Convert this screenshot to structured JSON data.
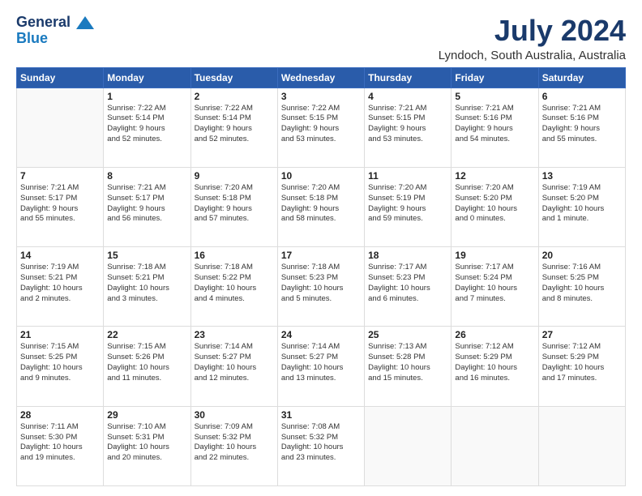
{
  "header": {
    "logo_line1": "General",
    "logo_line2": "Blue",
    "title": "July 2024",
    "subtitle": "Lyndoch, South Australia, Australia"
  },
  "weekdays": [
    "Sunday",
    "Monday",
    "Tuesday",
    "Wednesday",
    "Thursday",
    "Friday",
    "Saturday"
  ],
  "weeks": [
    [
      {
        "day": "",
        "info": ""
      },
      {
        "day": "1",
        "info": "Sunrise: 7:22 AM\nSunset: 5:14 PM\nDaylight: 9 hours\nand 52 minutes."
      },
      {
        "day": "2",
        "info": "Sunrise: 7:22 AM\nSunset: 5:14 PM\nDaylight: 9 hours\nand 52 minutes."
      },
      {
        "day": "3",
        "info": "Sunrise: 7:22 AM\nSunset: 5:15 PM\nDaylight: 9 hours\nand 53 minutes."
      },
      {
        "day": "4",
        "info": "Sunrise: 7:21 AM\nSunset: 5:15 PM\nDaylight: 9 hours\nand 53 minutes."
      },
      {
        "day": "5",
        "info": "Sunrise: 7:21 AM\nSunset: 5:16 PM\nDaylight: 9 hours\nand 54 minutes."
      },
      {
        "day": "6",
        "info": "Sunrise: 7:21 AM\nSunset: 5:16 PM\nDaylight: 9 hours\nand 55 minutes."
      }
    ],
    [
      {
        "day": "7",
        "info": "Sunrise: 7:21 AM\nSunset: 5:17 PM\nDaylight: 9 hours\nand 55 minutes."
      },
      {
        "day": "8",
        "info": "Sunrise: 7:21 AM\nSunset: 5:17 PM\nDaylight: 9 hours\nand 56 minutes."
      },
      {
        "day": "9",
        "info": "Sunrise: 7:20 AM\nSunset: 5:18 PM\nDaylight: 9 hours\nand 57 minutes."
      },
      {
        "day": "10",
        "info": "Sunrise: 7:20 AM\nSunset: 5:18 PM\nDaylight: 9 hours\nand 58 minutes."
      },
      {
        "day": "11",
        "info": "Sunrise: 7:20 AM\nSunset: 5:19 PM\nDaylight: 9 hours\nand 59 minutes."
      },
      {
        "day": "12",
        "info": "Sunrise: 7:20 AM\nSunset: 5:20 PM\nDaylight: 10 hours\nand 0 minutes."
      },
      {
        "day": "13",
        "info": "Sunrise: 7:19 AM\nSunset: 5:20 PM\nDaylight: 10 hours\nand 1 minute."
      }
    ],
    [
      {
        "day": "14",
        "info": "Sunrise: 7:19 AM\nSunset: 5:21 PM\nDaylight: 10 hours\nand 2 minutes."
      },
      {
        "day": "15",
        "info": "Sunrise: 7:18 AM\nSunset: 5:21 PM\nDaylight: 10 hours\nand 3 minutes."
      },
      {
        "day": "16",
        "info": "Sunrise: 7:18 AM\nSunset: 5:22 PM\nDaylight: 10 hours\nand 4 minutes."
      },
      {
        "day": "17",
        "info": "Sunrise: 7:18 AM\nSunset: 5:23 PM\nDaylight: 10 hours\nand 5 minutes."
      },
      {
        "day": "18",
        "info": "Sunrise: 7:17 AM\nSunset: 5:23 PM\nDaylight: 10 hours\nand 6 minutes."
      },
      {
        "day": "19",
        "info": "Sunrise: 7:17 AM\nSunset: 5:24 PM\nDaylight: 10 hours\nand 7 minutes."
      },
      {
        "day": "20",
        "info": "Sunrise: 7:16 AM\nSunset: 5:25 PM\nDaylight: 10 hours\nand 8 minutes."
      }
    ],
    [
      {
        "day": "21",
        "info": "Sunrise: 7:15 AM\nSunset: 5:25 PM\nDaylight: 10 hours\nand 9 minutes."
      },
      {
        "day": "22",
        "info": "Sunrise: 7:15 AM\nSunset: 5:26 PM\nDaylight: 10 hours\nand 11 minutes."
      },
      {
        "day": "23",
        "info": "Sunrise: 7:14 AM\nSunset: 5:27 PM\nDaylight: 10 hours\nand 12 minutes."
      },
      {
        "day": "24",
        "info": "Sunrise: 7:14 AM\nSunset: 5:27 PM\nDaylight: 10 hours\nand 13 minutes."
      },
      {
        "day": "25",
        "info": "Sunrise: 7:13 AM\nSunset: 5:28 PM\nDaylight: 10 hours\nand 15 minutes."
      },
      {
        "day": "26",
        "info": "Sunrise: 7:12 AM\nSunset: 5:29 PM\nDaylight: 10 hours\nand 16 minutes."
      },
      {
        "day": "27",
        "info": "Sunrise: 7:12 AM\nSunset: 5:29 PM\nDaylight: 10 hours\nand 17 minutes."
      }
    ],
    [
      {
        "day": "28",
        "info": "Sunrise: 7:11 AM\nSunset: 5:30 PM\nDaylight: 10 hours\nand 19 minutes."
      },
      {
        "day": "29",
        "info": "Sunrise: 7:10 AM\nSunset: 5:31 PM\nDaylight: 10 hours\nand 20 minutes."
      },
      {
        "day": "30",
        "info": "Sunrise: 7:09 AM\nSunset: 5:32 PM\nDaylight: 10 hours\nand 22 minutes."
      },
      {
        "day": "31",
        "info": "Sunrise: 7:08 AM\nSunset: 5:32 PM\nDaylight: 10 hours\nand 23 minutes."
      },
      {
        "day": "",
        "info": ""
      },
      {
        "day": "",
        "info": ""
      },
      {
        "day": "",
        "info": ""
      }
    ]
  ]
}
